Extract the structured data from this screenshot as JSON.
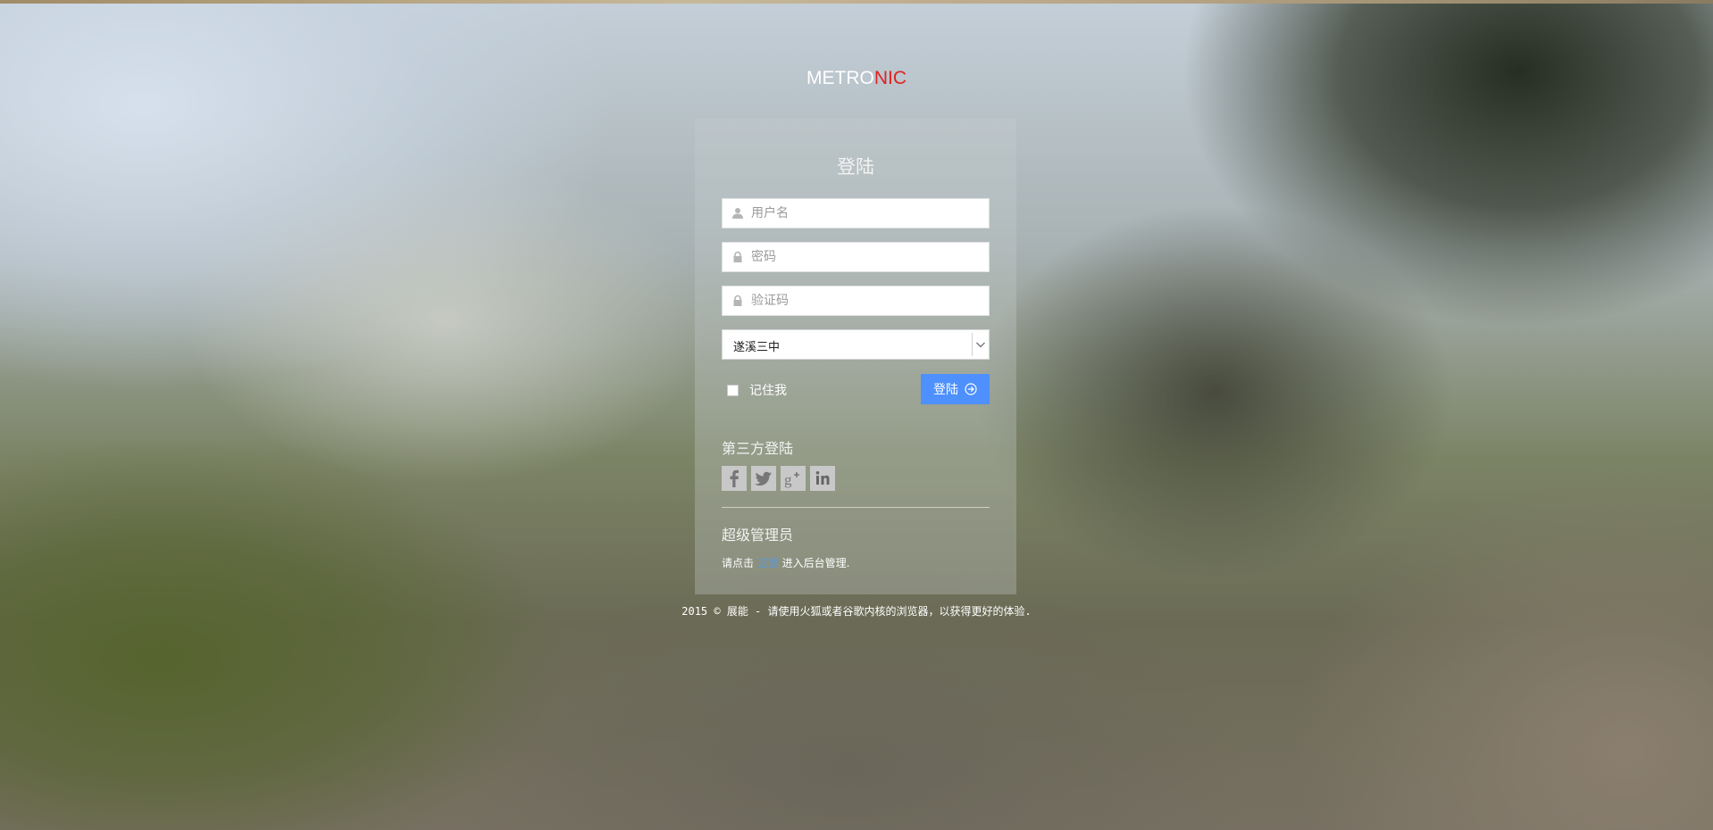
{
  "logo": {
    "main": "METRO",
    "accent": "NIC",
    "accent_color": "#e02222"
  },
  "form": {
    "title": "登陆",
    "username_placeholder": "用户名",
    "password_placeholder": "密码",
    "captcha_placeholder": "验证码",
    "school_select_value": "遂溪三中",
    "remember_label": "记住我",
    "login_button_label": "登陆",
    "login_button_color": "#4d90fe"
  },
  "social": {
    "title": "第三方登陆",
    "icons": [
      "facebook-icon",
      "twitter-icon",
      "googleplus-icon",
      "linkedin-icon"
    ]
  },
  "admin": {
    "title": "超级管理员",
    "text_before": "请点击 ",
    "link_text": "这里",
    "text_after": " 进入后台管理."
  },
  "footer": {
    "text": "2015 © 展能 - 请使用火狐或者谷歌内核的浏览器，以获得更好的体验."
  }
}
